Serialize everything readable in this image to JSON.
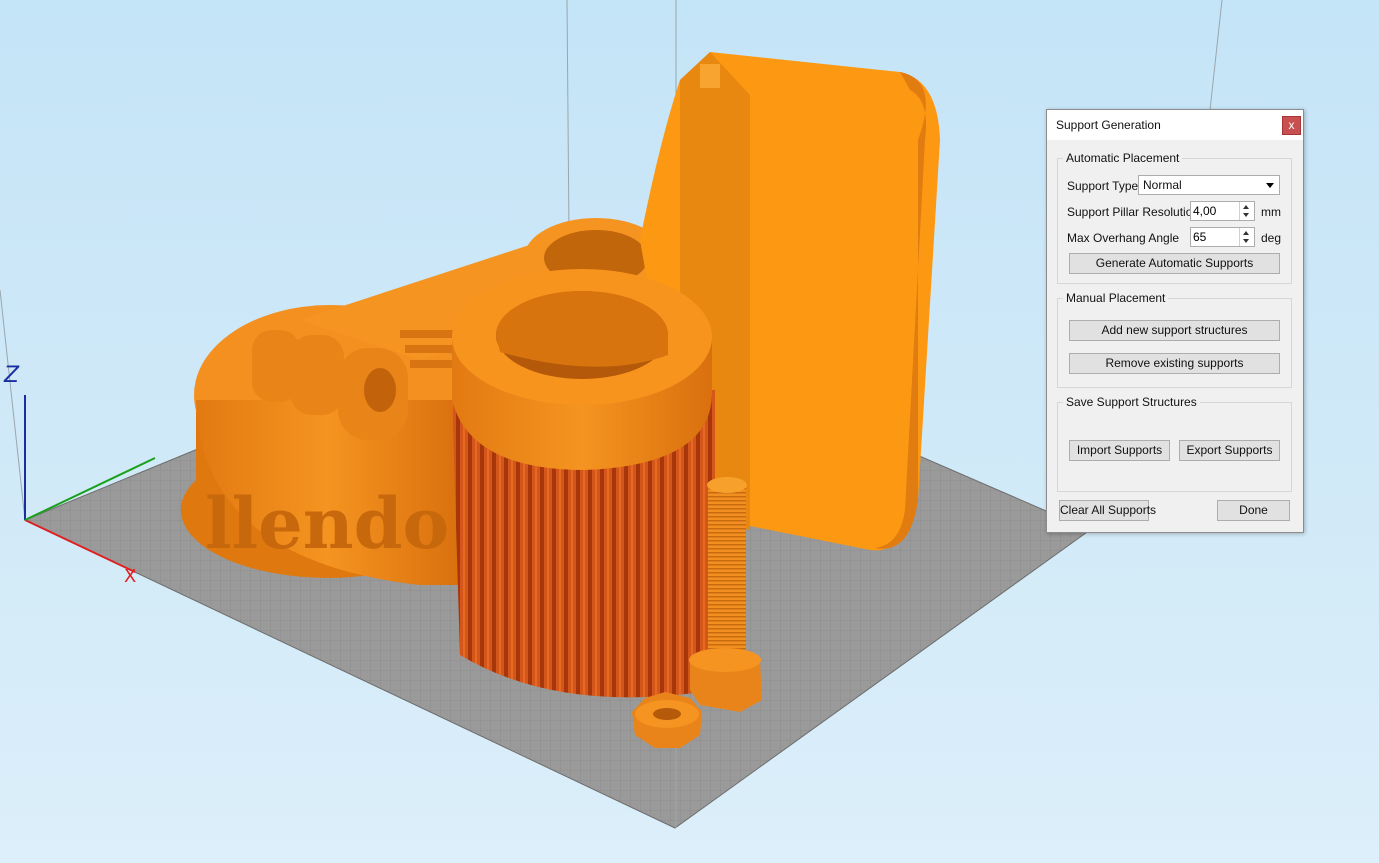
{
  "viewport": {
    "grid_color": "#8a8a8a",
    "model_color": "#f7901e",
    "support_color": "#c4460e",
    "axis_colors": {
      "x": "#e02020",
      "y": "#1aa01a",
      "z": "#1a2ea0"
    },
    "axis_labels": {
      "x": "X",
      "z": "Z"
    }
  },
  "dialog": {
    "title": "Support Generation",
    "close_label": "x",
    "automatic": {
      "title": "Automatic Placement",
      "support_type_label": "Support Type",
      "support_type_value": "Normal",
      "pillar_label": "Support Pillar Resolution",
      "pillar_value": "4,00",
      "pillar_unit": "mm",
      "overhang_label": "Max Overhang Angle",
      "overhang_value": "65",
      "overhang_unit": "deg",
      "generate_button": "Generate Automatic Supports"
    },
    "manual": {
      "title": "Manual Placement",
      "add_button": "Add new support structures",
      "remove_button": "Remove existing supports"
    },
    "save": {
      "title": "Save Support Structures",
      "import_button": "Import Supports",
      "export_button": "Export Supports"
    },
    "clear_button": "Clear All Supports",
    "done_button": "Done"
  }
}
